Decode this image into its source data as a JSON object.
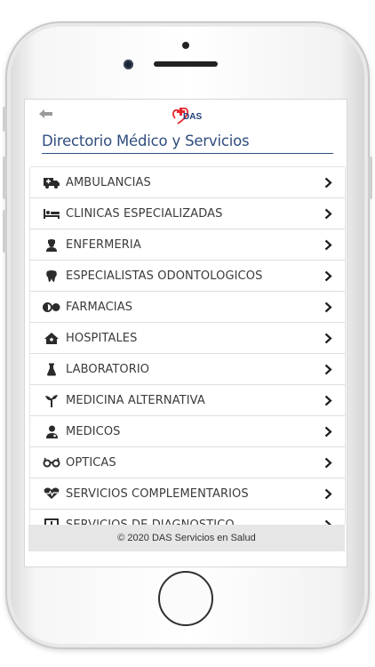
{
  "app": {
    "logo_text": "DAS",
    "title": "Directorio Médico y Servicios",
    "footer": "© 2020 DAS Servicios en Salud"
  },
  "menu": [
    {
      "label": "AMBULANCIAS",
      "icon": "ambulance-icon"
    },
    {
      "label": "CLINICAS ESPECIALIZADAS",
      "icon": "bed-icon"
    },
    {
      "label": "ENFERMERIA",
      "icon": "nurse-icon"
    },
    {
      "label": "ESPECIALISTAS ODONTOLOGICOS",
      "icon": "tooth-icon"
    },
    {
      "label": "FARMACIAS",
      "icon": "pills-icon"
    },
    {
      "label": "HOSPITALES",
      "icon": "clinic-home-icon"
    },
    {
      "label": "LABORATORIO",
      "icon": "flask-icon"
    },
    {
      "label": "MEDICINA ALTERNATIVA",
      "icon": "seedling-icon"
    },
    {
      "label": "MEDICOS",
      "icon": "doctor-icon"
    },
    {
      "label": "OPTICAS",
      "icon": "glasses-icon"
    },
    {
      "label": "SERVICIOS COMPLEMENTARIOS",
      "icon": "heartbeat-icon"
    },
    {
      "label": "SERVICIOS DE DIAGNOSTICO",
      "icon": "xray-icon"
    }
  ],
  "colors": {
    "title": "#2f4d7e",
    "accent_red": "#e4262c",
    "logo_blue": "#1f3d7a",
    "icon": "#2b2b2b"
  }
}
